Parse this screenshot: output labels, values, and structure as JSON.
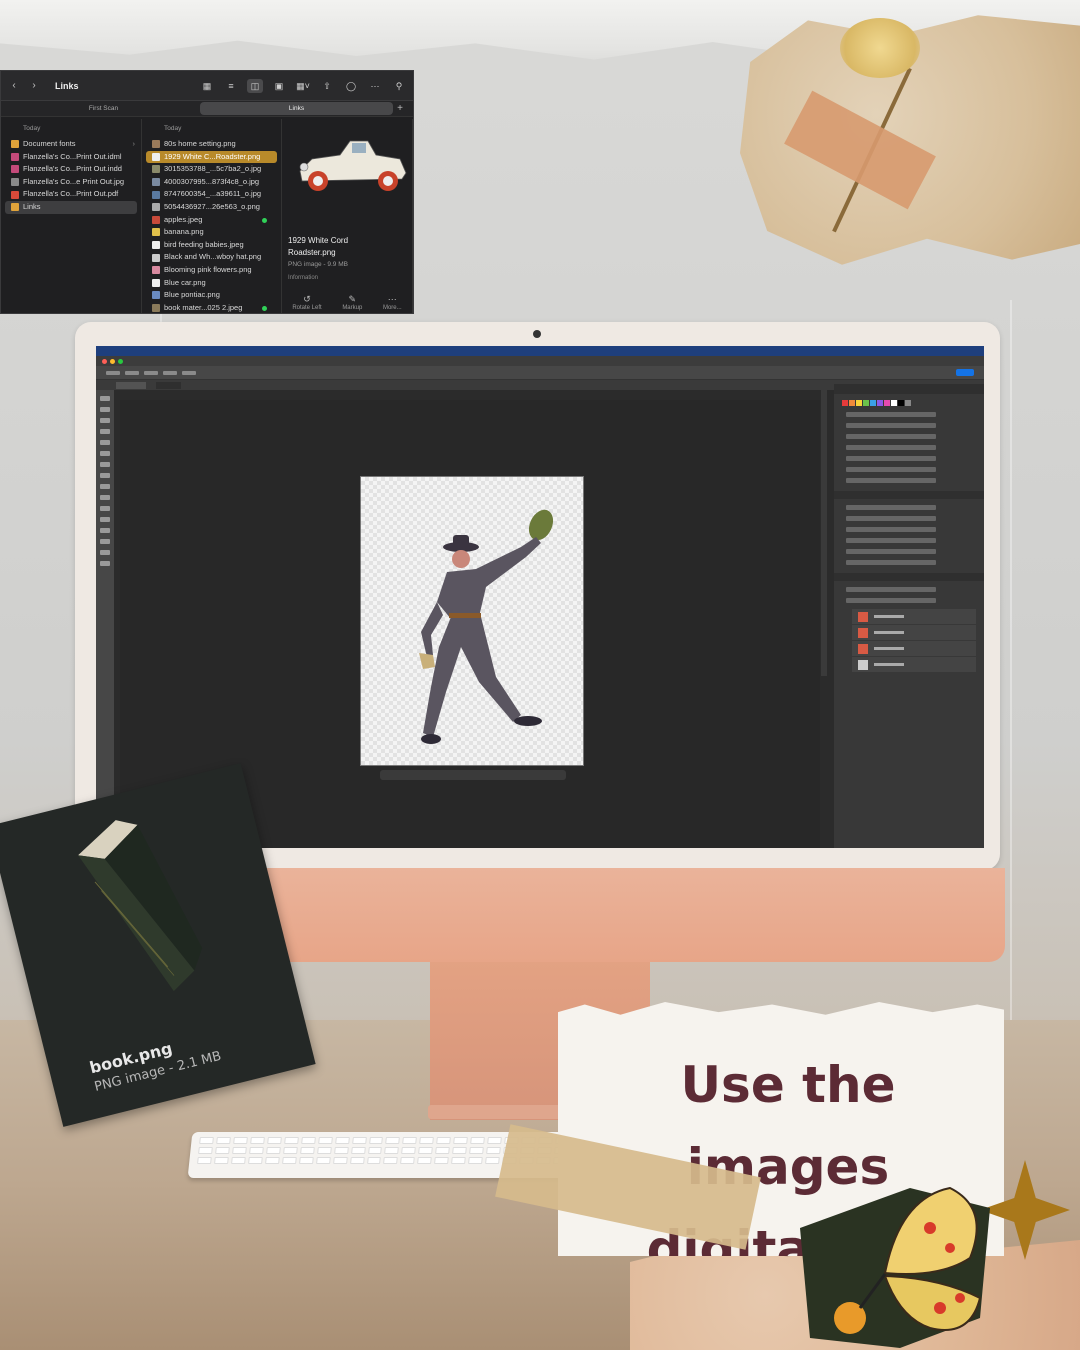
{
  "finder": {
    "title": "Links",
    "tabs": [
      "First Scan",
      "Links"
    ],
    "col1_header": "Today",
    "col2_header": "Today",
    "col1_items": [
      "Document fonts",
      "Flanzella's Co...Print Out.idml",
      "Flanzella's Co...Print Out.indd",
      "Flanzella's Co...e Print Out.jpg",
      "Flanzella's Co...Print Out.pdf",
      "Links"
    ],
    "col2_items": [
      "80s home setting.png",
      "1929 White C...Roadster.png",
      "3015353788_...5c7ba2_o.jpg",
      "4000307995...873f4c8_o.jpg",
      "8747600354_...a39611_o.jpg",
      "5054436927...26e563_o.png",
      "apples.jpeg",
      "banana.png",
      "bird feeding babies.jpeg",
      "Black and Wh...wboy hat.png",
      "Blooming pink flowers.png",
      "Blue car.png",
      "Blue pontiac.png",
      "book mater...025 2.jpeg"
    ],
    "preview": {
      "name_line1": "1929 White Cord",
      "name_line2": "Roadster.png",
      "meta": "PNG image - 9.9 MB",
      "info": "Information"
    },
    "actions": [
      "Rotate Left",
      "Markup",
      "More..."
    ]
  },
  "book_card": {
    "name": "book.png",
    "meta": "PNG image - 2.1 MB"
  },
  "note": {
    "line1": "Use the images",
    "line2": "digitally..."
  },
  "colors": {
    "note_text": "#5c2b35",
    "finder_selection": "#b88a2a",
    "imac_peach": "#e7a588"
  }
}
